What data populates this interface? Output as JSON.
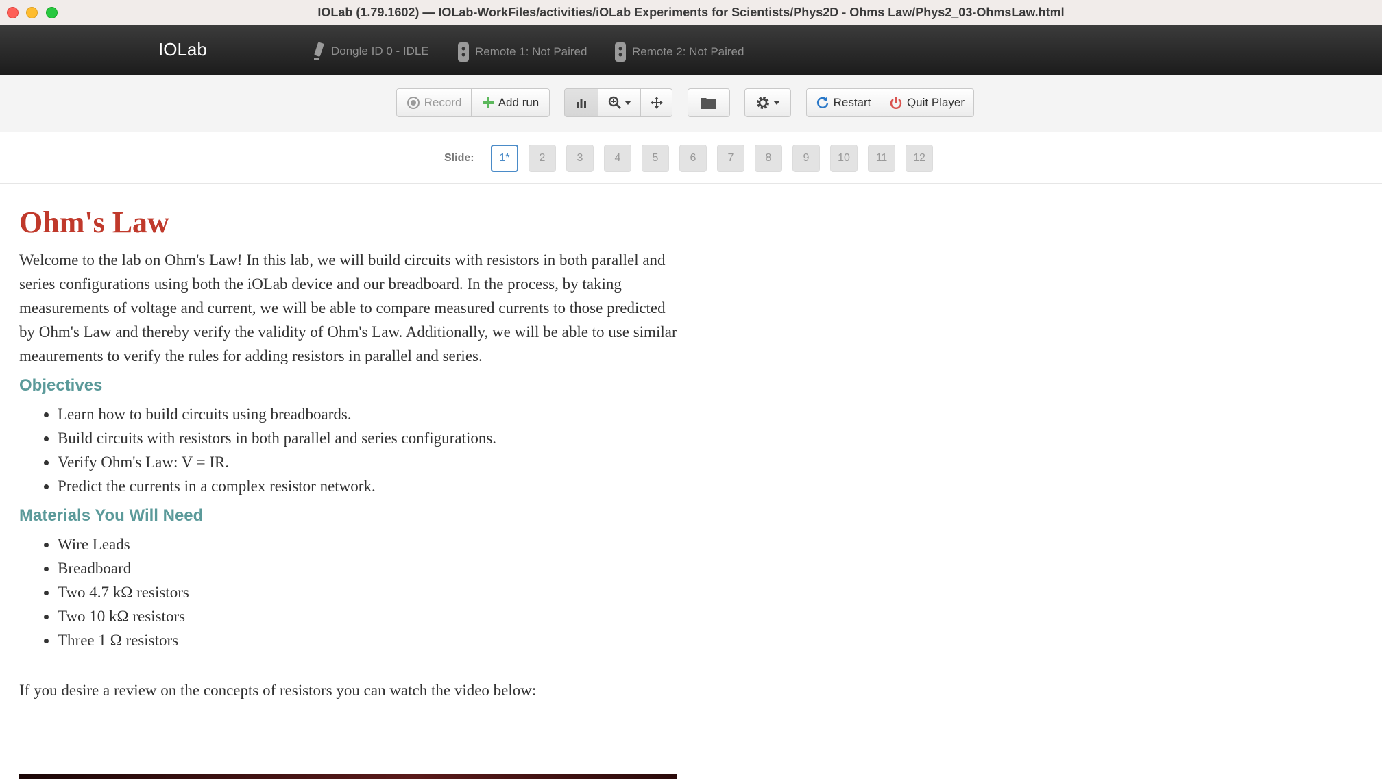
{
  "window": {
    "title": "IOLab (1.79.1602) — IOLab-WorkFiles/activities/iOLab Experiments for Scientists/Phys2D - Ohms Law/Phys2_03-OhmsLaw.html"
  },
  "navbar": {
    "brand": "IOLab",
    "dongle": "Dongle ID 0 - IDLE",
    "remote1": "Remote 1: Not Paired",
    "remote2": "Remote 2: Not Paired"
  },
  "toolbar": {
    "record_label": "Record",
    "add_run_label": "Add run",
    "restart_label": "Restart",
    "quit_label": "Quit Player"
  },
  "slides": {
    "label": "Slide:",
    "items": [
      "1*",
      "2",
      "3",
      "4",
      "5",
      "6",
      "7",
      "8",
      "9",
      "10",
      "11",
      "12"
    ],
    "active_index": 0
  },
  "content": {
    "title": "Ohm's Law",
    "intro": "Welcome to the lab on Ohm's Law! In this lab, we will build circuits with resistors in both parallel and series configurations using both the iOLab device and our breadboard. In the process, by taking measurements of voltage and current, we will be able to compare measured currents to those predicted by Ohm's Law and thereby verify the validity of Ohm's Law. Additionally, we will be able to use similar meaurements to verify the rules for adding resistors in parallel and series.",
    "objectives_title": "Objectives",
    "objectives": [
      "Learn how to build circuits using breadboards.",
      "Build circuits with resistors in both parallel and series configurations.",
      "Verify Ohm's Law: V = IR.",
      "Predict the currents in a complex resistor network."
    ],
    "materials_title": "Materials You Will Need",
    "materials": [
      "Wire Leads",
      "Breadboard",
      "Two 4.7 kΩ resistors",
      "Two 10 kΩ resistors",
      "Three 1 Ω resistors"
    ],
    "review": "If you desire a review on the concepts of resistors you can watch the video below:"
  },
  "colors": {
    "title_red": "#c0392b",
    "section_teal": "#5b9a9a",
    "active_slide": "#4a8bc8",
    "restart_icon": "#2a78c8",
    "quit_icon": "#d9534f",
    "add_icon": "#5cb85c"
  }
}
